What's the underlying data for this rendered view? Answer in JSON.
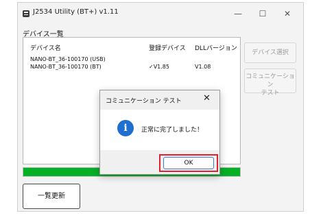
{
  "window": {
    "title": "J2534 Utility (BT+) v1.11",
    "controls": {
      "minimize": "—",
      "maximize": "☐",
      "close": "✕"
    }
  },
  "device_list": {
    "group_label": "デバイス一覧",
    "headers": [
      "デバイス名",
      "登録デバイス",
      "DLLバージョン"
    ],
    "rows": [
      [
        "NANO-BT_36-100170 (USB)",
        "",
        ""
      ],
      [
        "NANO-BT_36-100170 (BT)",
        "✓V1.85",
        "V1.08"
      ]
    ]
  },
  "side_buttons": {
    "select": "デバイス選択",
    "test_line1": "コミュニケーション",
    "test_line2": "テスト"
  },
  "progress": {
    "fraction": 1.0,
    "color": "#06b025"
  },
  "refresh_button": "一覧更新",
  "dialog": {
    "title": "コミュニケーション テスト",
    "close": "✕",
    "icon": "info-icon",
    "message": "正常に完了しました！",
    "ok": "OK"
  }
}
